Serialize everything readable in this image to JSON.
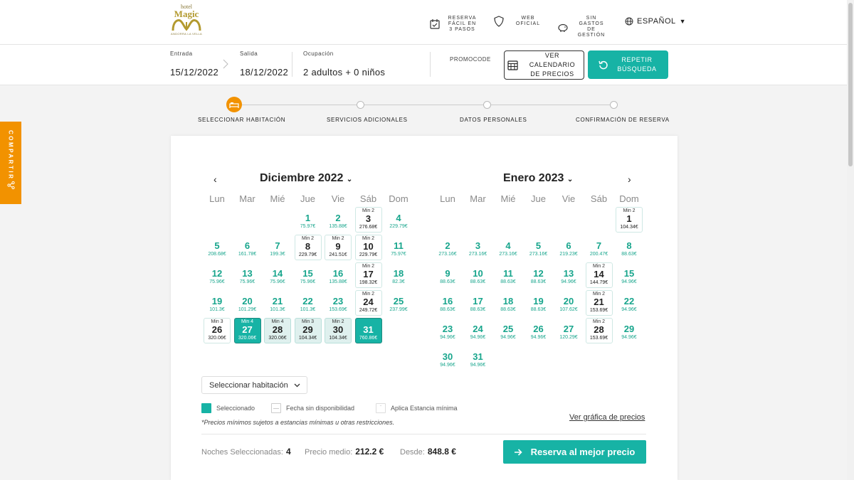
{
  "header": {
    "logo_top": "hotel",
    "logo_name": "Magic",
    "logo_sub": "ANDORRA LA VELLA",
    "feature1": "Reserva fácil en 3 pasos",
    "feature1_icon": "calendar-check-icon",
    "feature2": "Web oficial",
    "feature2_icon": "shield-icon",
    "feature3": "Sin gastos de gestión",
    "feature3_icon": "piggy-bank-icon",
    "language": "ESPAÑOL"
  },
  "search": {
    "checkin_label": "Entrada",
    "checkin_value": "15/12/2022",
    "checkout_label": "Salida",
    "checkout_value": "18/12/2022",
    "occupancy_label": "Ocupación",
    "occupancy_value": "2 adultos + 0 niños",
    "promo_label": "PROMOCODE",
    "calendar_button": "Ver calendario de precios",
    "repeat_button": "Repetir búsqueda"
  },
  "share_label": "COMPARTIR",
  "steps": [
    "SELECCIONAR HABITACIÓN",
    "SERVICIOS ADICIONALES",
    "DATOS PERSONALES",
    "CONFIRMACIÓN DE RESERVA"
  ],
  "calendar": {
    "weekdays": [
      "Lun",
      "Mar",
      "Mié",
      "Jue",
      "Vie",
      "Sáb",
      "Dom"
    ],
    "prev": "‹",
    "next": "›",
    "months": [
      {
        "title": "Diciembre 2022",
        "offset": 3,
        "days": [
          {
            "d": "1",
            "p": "75.97€",
            "s": "av"
          },
          {
            "d": "2",
            "p": "135.88€",
            "s": "av"
          },
          {
            "d": "3",
            "p": "276.68€",
            "s": "mb",
            "m": "Min 2"
          },
          {
            "d": "4",
            "p": "229.79€",
            "s": "av"
          },
          {
            "d": "5",
            "p": "208.68€",
            "s": "av"
          },
          {
            "d": "6",
            "p": "161.78€",
            "s": "av"
          },
          {
            "d": "7",
            "p": "199.3€",
            "s": "av"
          },
          {
            "d": "8",
            "p": "229.79€",
            "s": "mb",
            "m": "Min 2"
          },
          {
            "d": "9",
            "p": "241.51€",
            "s": "mb",
            "m": "Min 2"
          },
          {
            "d": "10",
            "p": "229.79€",
            "s": "mb",
            "m": "Min 2"
          },
          {
            "d": "11",
            "p": "75.97€",
            "s": "av"
          },
          {
            "d": "12",
            "p": "75.96€",
            "s": "av"
          },
          {
            "d": "13",
            "p": "75.96€",
            "s": "av"
          },
          {
            "d": "14",
            "p": "75.96€",
            "s": "av"
          },
          {
            "d": "15",
            "p": "75.96€",
            "s": "av"
          },
          {
            "d": "16",
            "p": "135.88€",
            "s": "av"
          },
          {
            "d": "17",
            "p": "198.32€",
            "s": "mb",
            "m": "Min 2"
          },
          {
            "d": "18",
            "p": "82.3€",
            "s": "av"
          },
          {
            "d": "19",
            "p": "101.3€",
            "s": "av"
          },
          {
            "d": "20",
            "p": "101.29€",
            "s": "av"
          },
          {
            "d": "21",
            "p": "101.3€",
            "s": "av"
          },
          {
            "d": "22",
            "p": "101.3€",
            "s": "av"
          },
          {
            "d": "23",
            "p": "153.69€",
            "s": "av"
          },
          {
            "d": "24",
            "p": "249.72€",
            "s": "mb",
            "m": "Min 2"
          },
          {
            "d": "25",
            "p": "237.99€",
            "s": "av"
          },
          {
            "d": "26",
            "p": "320.06€",
            "s": "mb",
            "m": "Min 3"
          },
          {
            "d": "27",
            "p": "320.06€",
            "s": "sel",
            "m": "Min 4"
          },
          {
            "d": "28",
            "p": "320.06€",
            "s": "rg",
            "m": "Min 4"
          },
          {
            "d": "29",
            "p": "104.34€",
            "s": "rg",
            "m": "Min 3"
          },
          {
            "d": "30",
            "p": "104.34€",
            "s": "rg",
            "m": "Min 2"
          },
          {
            "d": "31",
            "p": "760.86€",
            "s": "sel"
          }
        ]
      },
      {
        "title": "Enero 2023",
        "offset": 6,
        "days": [
          {
            "d": "1",
            "p": "104.34€",
            "s": "mb",
            "m": "Min 2"
          },
          {
            "d": "2",
            "p": "273.16€",
            "s": "av"
          },
          {
            "d": "3",
            "p": "273.16€",
            "s": "av"
          },
          {
            "d": "4",
            "p": "273.16€",
            "s": "av"
          },
          {
            "d": "5",
            "p": "273.16€",
            "s": "av"
          },
          {
            "d": "6",
            "p": "219.23€",
            "s": "av"
          },
          {
            "d": "7",
            "p": "200.47€",
            "s": "av"
          },
          {
            "d": "8",
            "p": "88.63€",
            "s": "av"
          },
          {
            "d": "9",
            "p": "88.63€",
            "s": "av"
          },
          {
            "d": "10",
            "p": "88.63€",
            "s": "av"
          },
          {
            "d": "11",
            "p": "88.63€",
            "s": "av"
          },
          {
            "d": "12",
            "p": "88.63€",
            "s": "av"
          },
          {
            "d": "13",
            "p": "94.96€",
            "s": "av"
          },
          {
            "d": "14",
            "p": "144.79€",
            "s": "mb",
            "m": "Min 2"
          },
          {
            "d": "15",
            "p": "94.96€",
            "s": "av"
          },
          {
            "d": "16",
            "p": "88.63€",
            "s": "av"
          },
          {
            "d": "17",
            "p": "88.63€",
            "s": "av"
          },
          {
            "d": "18",
            "p": "88.63€",
            "s": "av"
          },
          {
            "d": "19",
            "p": "88.63€",
            "s": "av"
          },
          {
            "d": "20",
            "p": "107.62€",
            "s": "av"
          },
          {
            "d": "21",
            "p": "153.69€",
            "s": "mb",
            "m": "Min 2"
          },
          {
            "d": "22",
            "p": "94.96€",
            "s": "av"
          },
          {
            "d": "23",
            "p": "94.96€",
            "s": "av"
          },
          {
            "d": "24",
            "p": "94.96€",
            "s": "av"
          },
          {
            "d": "25",
            "p": "94.96€",
            "s": "av"
          },
          {
            "d": "26",
            "p": "94.96€",
            "s": "av"
          },
          {
            "d": "27",
            "p": "120.29€",
            "s": "av"
          },
          {
            "d": "28",
            "p": "153.69€",
            "s": "mb",
            "m": "Min 2"
          },
          {
            "d": "29",
            "p": "94.96€",
            "s": "av"
          },
          {
            "d": "30",
            "p": "94.96€",
            "s": "av"
          },
          {
            "d": "31",
            "p": "94.96€",
            "s": "av"
          }
        ]
      }
    ]
  },
  "room_select": "Seleccionar habitación",
  "legend": {
    "selected": "Seleccionado",
    "unavailable": "Fecha sin disponibilidad",
    "min_stay": "Aplica Estancia mínima",
    "selected_color": "#17b3a5"
  },
  "note": "*Precios mínimos sujetos a estancias mínimas u otras restricciones.",
  "price_graph_link": "Ver gráfica de precios",
  "summary": {
    "nights_label": "Noches Seleccionadas:",
    "nights_value": "4",
    "avg_label": "Precio medio:",
    "avg_value": "212.2 €",
    "from_label": "Desde:",
    "from_value": "848.8 €",
    "book_button": "Reserva al mejor precio"
  },
  "colors": {
    "accent": "#17b3a5",
    "orange": "#f29200",
    "gold": "#b39a2f"
  }
}
